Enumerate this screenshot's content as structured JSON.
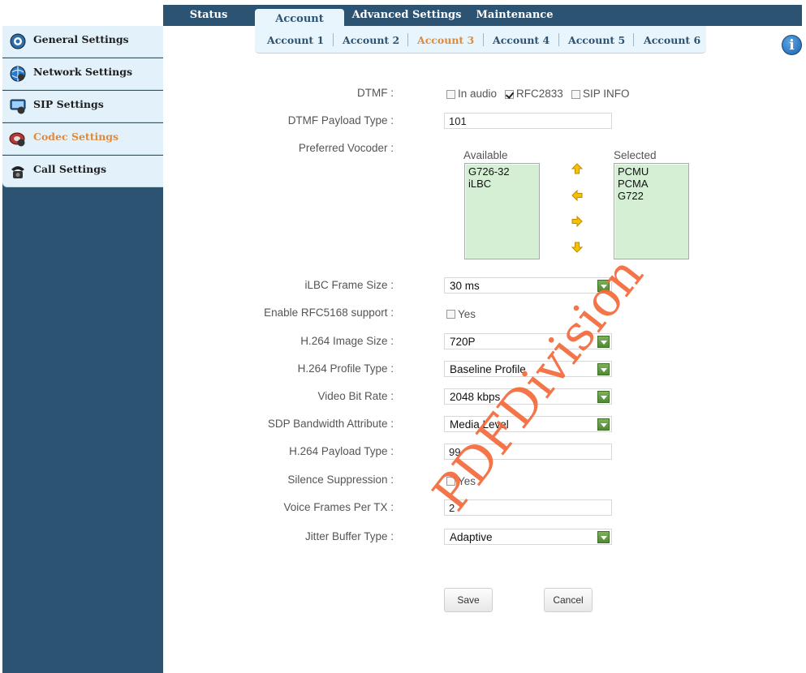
{
  "top_tabs": [
    "Status",
    "Account",
    "Advanced Settings",
    "Maintenance"
  ],
  "sub_tabs": [
    "Account 1",
    "Account 2",
    "Account 3",
    "Account 4",
    "Account 5",
    "Account 6"
  ],
  "sidebar": {
    "items": [
      {
        "label": "General Settings",
        "icon": "general-settings-icon"
      },
      {
        "label": "Network Settings",
        "icon": "network-settings-icon"
      },
      {
        "label": "SIP Settings",
        "icon": "sip-settings-icon"
      },
      {
        "label": "Codec Settings",
        "icon": "codec-settings-icon"
      },
      {
        "label": "Call Settings",
        "icon": "call-settings-icon"
      }
    ]
  },
  "form": {
    "dtmf": {
      "label": "DTMF :",
      "options": [
        {
          "label": "In audio",
          "checked": false
        },
        {
          "label": "RFC2833",
          "checked": true
        },
        {
          "label": "SIP INFO",
          "checked": false
        }
      ]
    },
    "dtmf_payload": {
      "label": "DTMF Payload Type :",
      "value": "101"
    },
    "vocoder": {
      "label": "Preferred Vocoder :",
      "available_label": "Available",
      "selected_label": "Selected",
      "available": [
        "G726-32",
        "iLBC"
      ],
      "selected": [
        "PCMU",
        "PCMA",
        "G722"
      ]
    },
    "ilbc_frame": {
      "label": "iLBC Frame Size :",
      "value": "30 ms"
    },
    "rfc5168": {
      "label": "Enable RFC5168 support :",
      "option": "Yes",
      "checked": false
    },
    "h264_image": {
      "label": "H.264 Image Size :",
      "value": "720P"
    },
    "h264_profile": {
      "label": "H.264 Profile Type :",
      "value": "Baseline Profile"
    },
    "video_bitrate": {
      "label": "Video Bit Rate :",
      "value": "2048 kbps"
    },
    "sdp_bandwidth": {
      "label": "SDP Bandwidth Attribute :",
      "value": "Media Level"
    },
    "h264_payload": {
      "label": "H.264 Payload Type :",
      "value": "99"
    },
    "silence": {
      "label": "Silence Suppression :",
      "option": "Yes",
      "checked": false
    },
    "voice_frames": {
      "label": "Voice Frames Per TX :",
      "value": "2"
    },
    "jitter": {
      "label": "Jitter Buffer Type :",
      "value": "Adaptive"
    }
  },
  "buttons": {
    "save": "Save",
    "cancel": "Cancel"
  },
  "watermark": "PDFDivision",
  "colors": {
    "nav_dark": "#2d5373",
    "nav_light": "#e2f1fa",
    "accent": "#e08a3c",
    "list_bg": "#d5efd5",
    "watermark": "#f26a3a"
  }
}
